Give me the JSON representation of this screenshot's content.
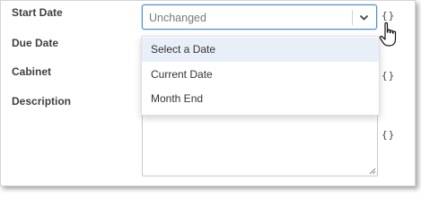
{
  "form": {
    "start_date_label": "Start Date",
    "due_date_label": "Due Date",
    "cabinet_label": "Cabinet",
    "description_label": "Description",
    "start_date_value": "Unchanged",
    "variable_brace": "{}"
  },
  "dropdown": {
    "options": [
      "Select a Date",
      "Current Date",
      "Month End"
    ],
    "highlighted_index": 0
  },
  "icons": {
    "chevron": "chevron-down-icon",
    "cursor": "hand-pointer-icon",
    "resize": "resize-grip-icon"
  },
  "colors": {
    "focus_border": "#4f8ed1",
    "highlight_bg": "#e9eff8"
  }
}
